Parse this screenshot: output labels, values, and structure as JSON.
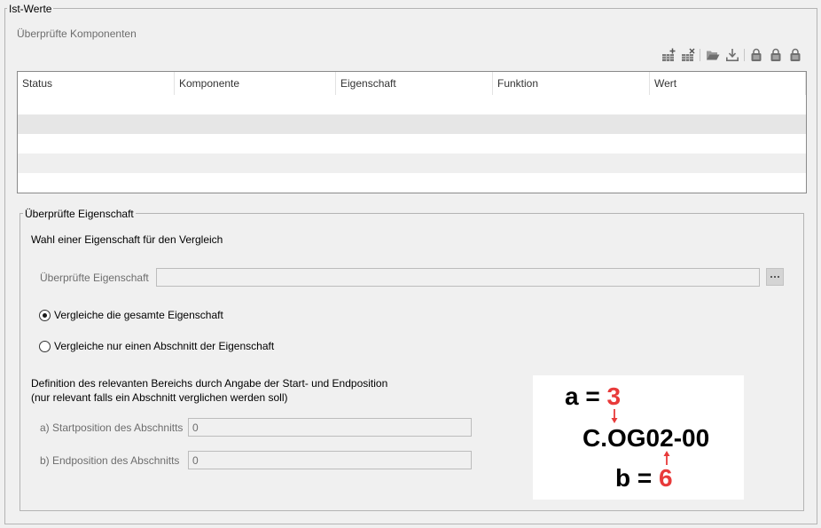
{
  "outer_group": {
    "title": "Ist-Werte"
  },
  "components": {
    "label": "Überprüfte Komponenten",
    "toolbar": {
      "icons": [
        "add-row-icon",
        "delete-row-icon",
        "folder-open-icon",
        "import-icon",
        "clipboard-icon",
        "clipboard-icon",
        "clipboard-icon"
      ]
    },
    "table": {
      "columns": [
        "Status",
        "Komponente",
        "Eigenschaft",
        "Funktion",
        "Wert"
      ],
      "rows": [
        [
          "",
          "",
          "",
          "",
          ""
        ],
        [
          "",
          "",
          "",
          "",
          ""
        ],
        [
          "",
          "",
          "",
          "",
          ""
        ],
        [
          "",
          "",
          "",
          "",
          ""
        ],
        [
          "",
          "",
          "",
          "",
          ""
        ]
      ]
    }
  },
  "property_group": {
    "title": "Überprüfte Eigenschaft",
    "intro": "Wahl einer Eigenschaft für den Vergleich",
    "property_field": {
      "label": "Überprüfte Eigenschaft",
      "value": "",
      "browse_icon": "ellipsis-icon"
    },
    "compare_mode": {
      "options": [
        {
          "label": "Vergleiche die gesamte Eigenschaft",
          "checked": true
        },
        {
          "label": "Vergleiche nur einen Abschnitt der Eigenschaft",
          "checked": false
        }
      ]
    },
    "range": {
      "description": [
        "Definition des relevanten Bereichs durch Angabe der Start- und Endposition",
        "(nur relevant falls ein Abschnitt verglichen werden soll)"
      ],
      "start": {
        "label": "a) Startposition des Abschnitts",
        "value": "0"
      },
      "end": {
        "label": "b) Endposition des Abschnitts",
        "value": "0"
      }
    },
    "illustration": {
      "start_prefix": "a = ",
      "start_value": "3",
      "example": "C.OG02-00",
      "end_prefix": "b = ",
      "end_value": "6",
      "highlight_color": "#e83a3a"
    }
  }
}
